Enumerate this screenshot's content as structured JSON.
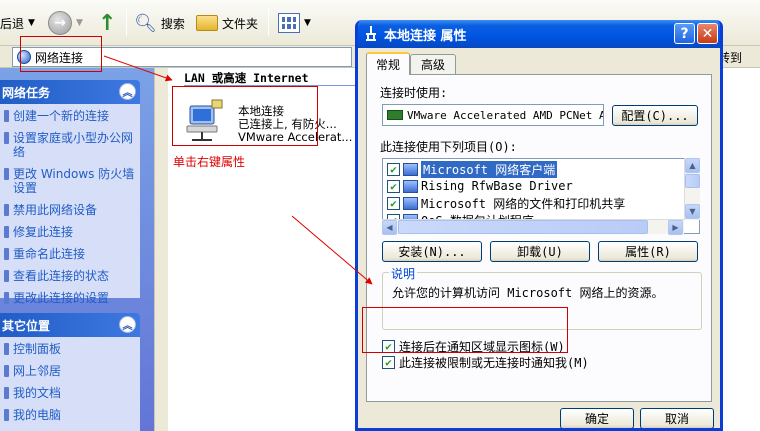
{
  "explorer": {
    "toolbar": {
      "back_label": "后退",
      "search_label": "搜索",
      "folders_label": "文件夹"
    },
    "address": {
      "value": "网络连接",
      "goto_label": "转到"
    },
    "tasks_panel": {
      "title": "网络任务",
      "items": [
        "创建一个新的连接",
        "设置家庭或小型办公网络",
        "更改 Windows 防火墙设置",
        "禁用此网络设备",
        "修复此连接",
        "重命名此连接",
        "查看此连接的状态",
        "更改此连接的设置"
      ]
    },
    "other_places_panel": {
      "title": "其它位置",
      "items": [
        "控制面板",
        "网上邻居",
        "我的文档",
        "我的电脑"
      ]
    },
    "content": {
      "group_header": "LAN 或高速 Internet",
      "connection": {
        "name": "本地连接",
        "status": "已连接上, 有防火...",
        "device": "VMware Accelerat..."
      },
      "annotation": "单击右键属性"
    }
  },
  "dialog": {
    "title": "本地连接 属性",
    "help_glyph": "?",
    "close_glyph": "✕",
    "tabs": [
      "常规",
      "高级"
    ],
    "connect_using_label": "连接时使用:",
    "adapter_name": "VMware Accelerated AMD PCNet A",
    "configure_button": "配置(C)...",
    "items_label": "此连接使用下列项目(O):",
    "components": [
      {
        "name": "Microsoft 网络客户端",
        "checked": true,
        "selected": true
      },
      {
        "name": "Rising RfwBase Driver",
        "checked": true,
        "selected": false
      },
      {
        "name": "Microsoft 网络的文件和打印机共享",
        "checked": true,
        "selected": false
      },
      {
        "name": "QoS 数据包计划程序",
        "checked": true,
        "selected": false
      }
    ],
    "install_button": "安装(N)...",
    "uninstall_button": "卸载(U)",
    "properties_button": "属性(R)",
    "description_title": "说明",
    "description_text": "允许您的计算机访问 Microsoft 网络上的资源。",
    "show_icon_option": {
      "label": "连接后在通知区域显示图标(W)",
      "checked": true
    },
    "notify_option": {
      "label": "此连接被限制或无连接时通知我(M)",
      "checked": true
    },
    "ok_button": "确定",
    "cancel_button": "取消"
  }
}
